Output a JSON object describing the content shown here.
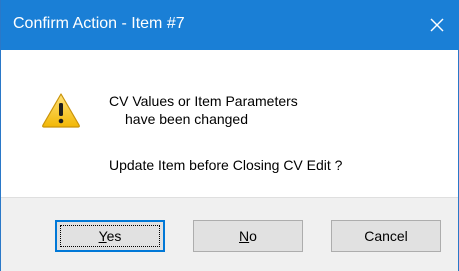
{
  "window": {
    "title": "Confirm Action - Item #7",
    "close_icon": "close-icon",
    "title_bar_color": "#1a7fd6"
  },
  "message": {
    "icon": "warning-icon",
    "line1": "CV Values or Item Parameters",
    "line2": "have been changed",
    "line3": "Update Item before Closing CV Edit ?"
  },
  "buttons": {
    "yes": {
      "label_mnemonic": "Y",
      "label_rest": "es",
      "is_default": true
    },
    "no": {
      "label_mnemonic": "N",
      "label_rest": "o"
    },
    "cancel": {
      "label": "Cancel"
    }
  }
}
